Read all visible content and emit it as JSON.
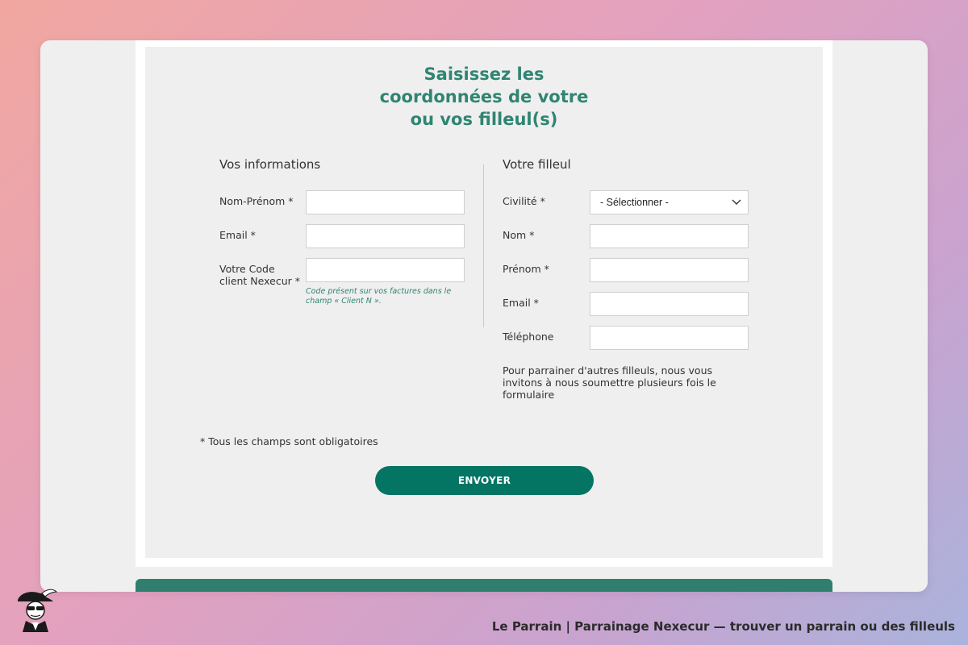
{
  "form": {
    "title_lines": [
      "Saisissez les",
      "coordonnées de votre",
      "ou vos filleul(s)"
    ],
    "left": {
      "section_title": "Vos informations",
      "fields": {
        "nom_prenom": "Nom-Prénom *",
        "email": "Email *",
        "code_client_line1": "Votre Code",
        "code_client_line2": "client Nexecur *"
      },
      "code_hint_line1": "Code présent sur vos factures dans le",
      "code_hint_line2": "champ « Client N »."
    },
    "right": {
      "section_title": "Votre filleul",
      "civilite_label": "Civilité *",
      "civilite_selected": "- Sélectionner -",
      "nom_label": "Nom *",
      "prenom_label": "Prénom *",
      "email_label": "Email *",
      "telephone_label": "Téléphone",
      "note_line1": "Pour parrainer d'autres filleuls, nous vous",
      "note_line2": "invitons à nous soumettre plusieurs fois le",
      "note_line3": "formulaire"
    },
    "required_note": "* Tous les champs sont obligatoires",
    "submit_label": "ENVOYER"
  },
  "caption": "Le Parrain | Parrainage Nexecur — trouver un parrain ou des filleuls",
  "icons": {
    "dropdown": "chevron-down-icon",
    "logo": "parrain-logo-icon"
  },
  "colors": {
    "accent": "#2f8572",
    "button": "#047562",
    "footer": "#2f7e6e",
    "panel": "#efefef"
  }
}
